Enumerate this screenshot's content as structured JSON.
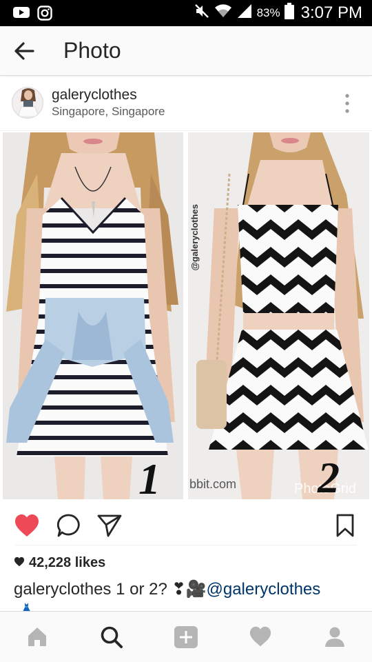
{
  "status_bar": {
    "battery_percent": "83%",
    "time": "3:07 PM",
    "icons": [
      "youtube-icon",
      "instagram-icon",
      "mute-icon",
      "wifi-icon",
      "signal-icon",
      "battery-icon"
    ]
  },
  "app_bar": {
    "title": "Photo",
    "back_icon": "arrow-left-icon"
  },
  "post": {
    "username": "galeryclothes",
    "location": "Singapore, Singapore",
    "photo": {
      "panel_1_number": "1",
      "panel_2_number": "2",
      "watermark_vertical": "@galeryclothes",
      "watermark_left": "bbit.com",
      "watermark_right": "PhotoGrid"
    },
    "likes_text": "42,228 likes",
    "caption_username": "galeryclothes",
    "caption_text": "1 or 2? ❣🎥",
    "caption_mention": "@galeryclothes",
    "caption_trailing_emoji": "👗"
  },
  "actions": {
    "like_icon": "heart-filled-icon",
    "comment_icon": "comment-icon",
    "share_icon": "send-icon",
    "save_icon": "bookmark-icon"
  },
  "bottom_nav": {
    "items": [
      "home-icon",
      "search-icon",
      "add-icon",
      "heart-icon",
      "profile-icon"
    ],
    "active": "search-icon"
  },
  "colors": {
    "like_red": "#ed4956",
    "mention_blue": "#003569",
    "icon_gray": "#262626",
    "nav_gray": "#b5b5b5"
  }
}
